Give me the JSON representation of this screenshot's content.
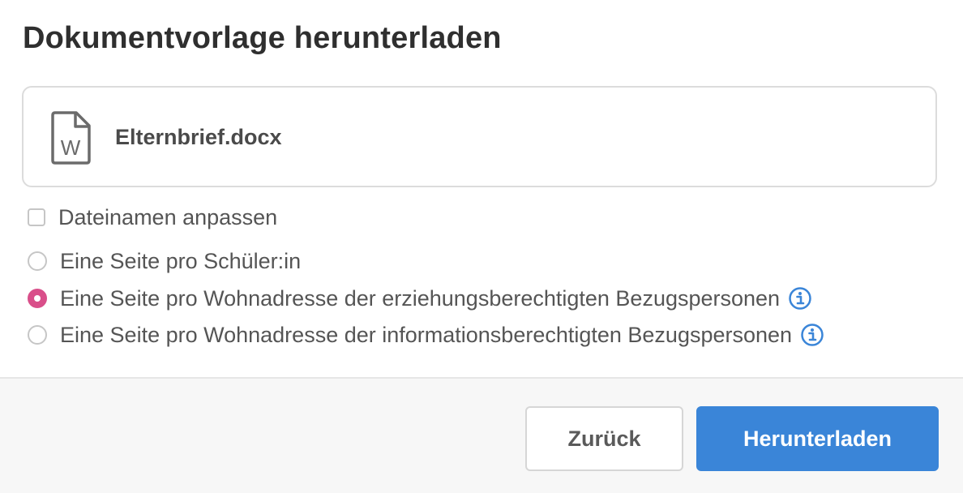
{
  "dialog": {
    "title": "Dokumentvorlage herunterladen",
    "file": {
      "name": "Elternbrief.docx",
      "icon": "word-document-icon",
      "icon_letter": "W"
    },
    "checkbox": {
      "label": "Dateinamen anpassen",
      "checked": false
    },
    "radio_options": [
      {
        "label": "Eine Seite pro Schüler:in",
        "checked": false,
        "has_info": false
      },
      {
        "label": "Eine Seite pro Wohnadresse der erziehungsberechtigten Bezugspersonen",
        "checked": true,
        "has_info": true
      },
      {
        "label": "Eine Seite pro Wohnadresse der informationsberechtigten Bezugspersonen",
        "checked": false,
        "has_info": true
      }
    ],
    "buttons": {
      "back": "Zurück",
      "download": "Herunterladen"
    },
    "colors": {
      "accent_radio": "#d94f8a",
      "primary_button": "#3a85d8",
      "info_icon": "#3a85d8"
    }
  }
}
